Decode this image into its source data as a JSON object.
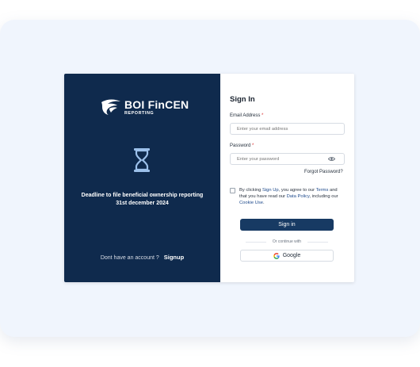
{
  "brand": {
    "title": "BOI FinCEN",
    "subtitle": "REPORTING"
  },
  "left_panel": {
    "deadline_line1": "Deadline to file beneficial ownership reporting",
    "deadline_line2": "31st december 2024",
    "no_account_text": "Dont have an account ?",
    "signup_link": "Signup"
  },
  "form": {
    "title": "Sign In",
    "email_label": "Email Address",
    "email_placeholder": "Enter your email address",
    "password_label": "Password",
    "password_placeholder": "Enter your password",
    "required_mark": "*",
    "forgot_password": "Forgot Password?",
    "terms": {
      "part1": "By clicking ",
      "signup_link": "Sign Up",
      "part2": ", you agree to our ",
      "terms_link": "Terms",
      "part3": " and that you have read our ",
      "data_policy_link": "Data Policy",
      "part4": ", including our ",
      "cookie_link": "Cookie Use",
      "part5": "."
    },
    "signin_button": "Sign in",
    "divider_text": "Or continue with",
    "google_button": "Google"
  },
  "colors": {
    "panel_bg": "#0f2a4d",
    "accent": "#173a63",
    "hourglass": "#9cc0ea",
    "link": "#1e4a8c",
    "required": "#d93030"
  },
  "icons": {
    "logo": "eagle-shield-icon",
    "hourglass": "hourglass-icon",
    "password_toggle": "eye-icon",
    "google": "google-g-icon"
  }
}
